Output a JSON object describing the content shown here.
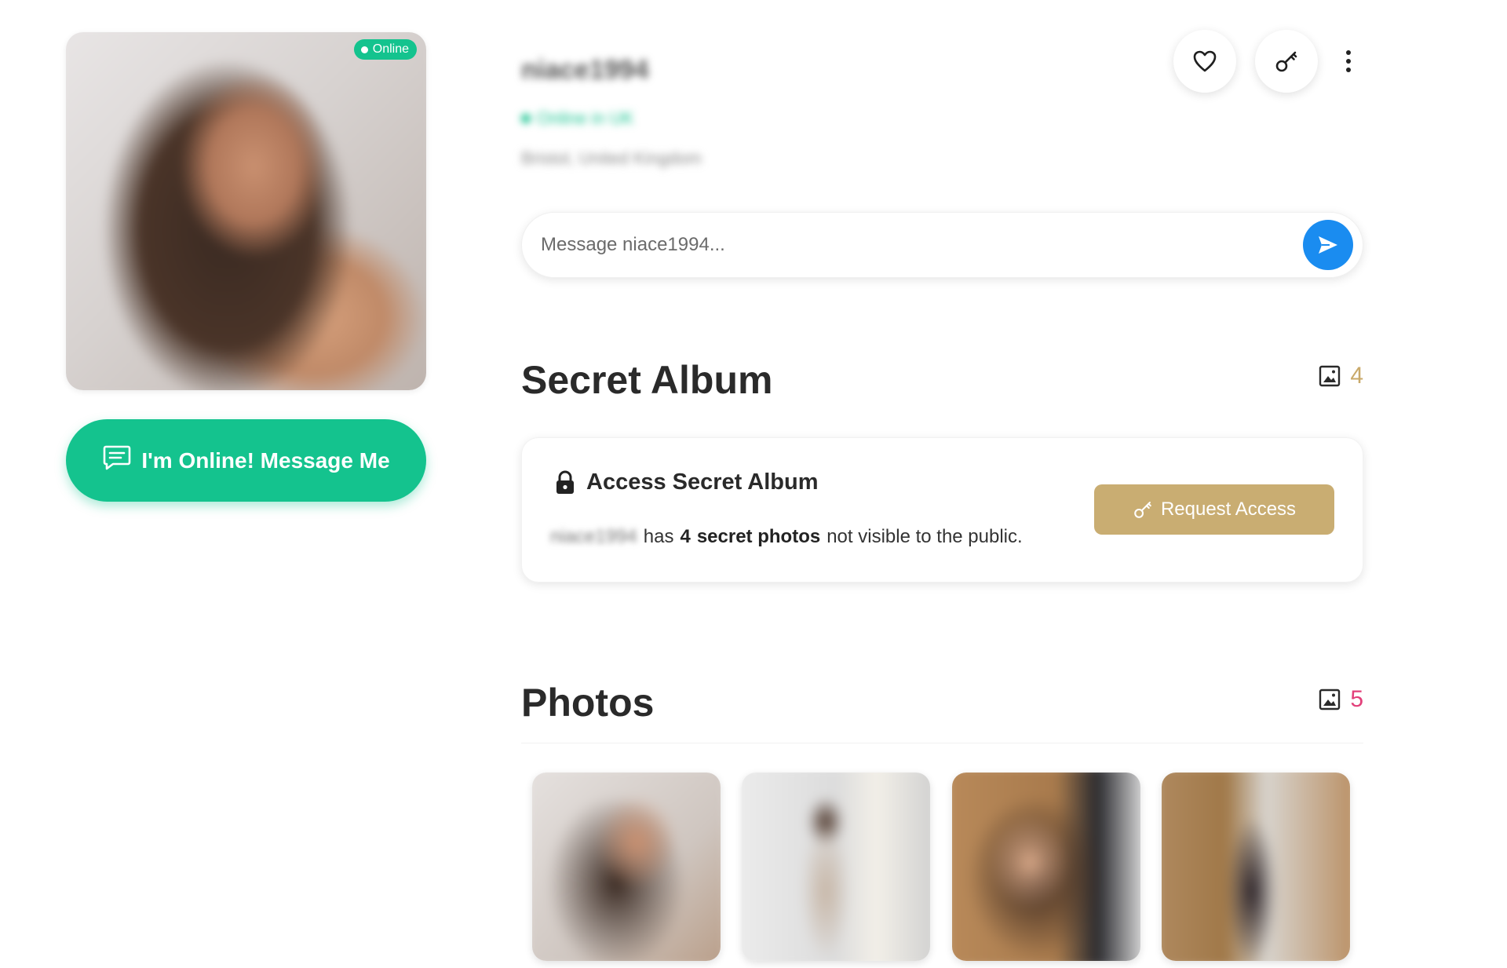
{
  "profile": {
    "username": "niace1994",
    "status_text": "Online in UK",
    "location": "Bristol, United Kingdom",
    "online_badge": "Online"
  },
  "cta": {
    "label": "I'm Online! Message Me"
  },
  "actions": {
    "favorite_icon": "heart-icon",
    "key_icon": "key-icon",
    "more_icon": "more-vertical-icon"
  },
  "message": {
    "placeholder": "Message niace1994...",
    "send_icon": "send-icon"
  },
  "secret_album": {
    "title": "Secret Album",
    "count": "4",
    "card_title": "Access Secret Album",
    "owner": "niace1994",
    "desc_has": "has",
    "desc_count": "4",
    "desc_bold": "secret photos",
    "desc_rest": "not visible to the public.",
    "request_label": "Request Access",
    "accent_color": "#c9ad72"
  },
  "photos": {
    "title": "Photos",
    "count": "5",
    "accent_color": "#e2407a",
    "visible_thumbs": 4
  },
  "colors": {
    "online_green": "#14c38e",
    "send_blue": "#1a8cf0"
  }
}
